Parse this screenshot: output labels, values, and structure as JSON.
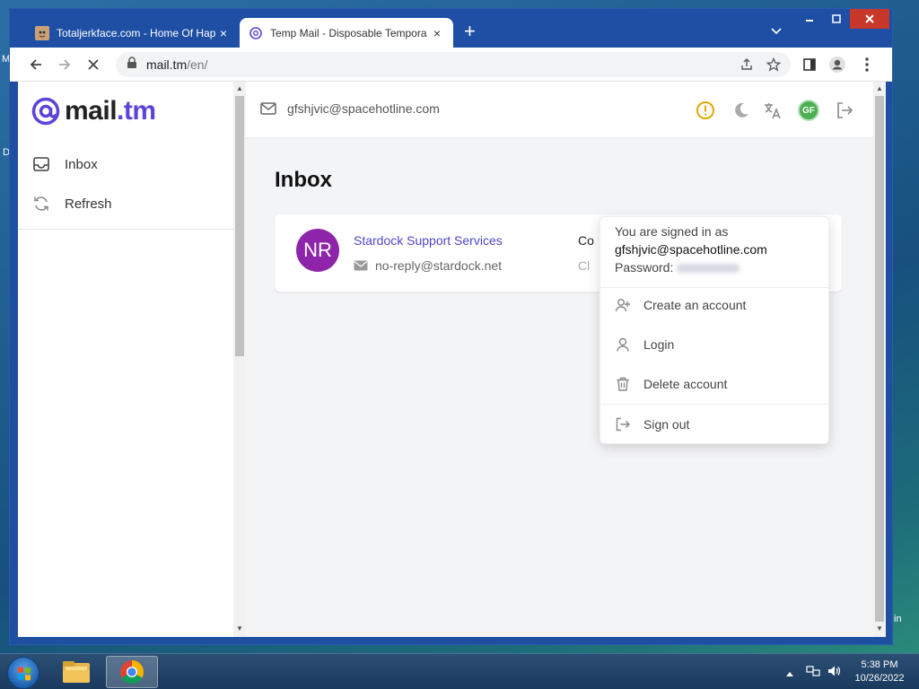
{
  "desktop": {
    "left_labels": [
      "M",
      "D"
    ],
    "right_label": "in"
  },
  "browser": {
    "tabs": [
      {
        "title": "Totaljerkface.com - Home Of Hap",
        "close": "×"
      },
      {
        "title": "Temp Mail - Disposable Tempora",
        "close": "×"
      }
    ],
    "new_tab": "+",
    "url_host": "mail.tm",
    "url_path": "/en/"
  },
  "sidebar": {
    "logo_at": "@",
    "logo_mail": "mail",
    "logo_tm": ".tm",
    "items": [
      {
        "label": "Inbox",
        "icon": "inbox-icon"
      },
      {
        "label": "Refresh",
        "icon": "refresh-icon"
      }
    ]
  },
  "header": {
    "email": "gfshjvic@spacehotline.com",
    "avatar_initials": "GF",
    "colors": {
      "warning": "#e0a800",
      "avatar": "#4caf50"
    }
  },
  "main": {
    "title": "Inbox",
    "messages": [
      {
        "initials": "NR",
        "sender": "Stardock Support Services",
        "from": "no-reply@stardock.net",
        "subject": "Co",
        "snippet": "Cl",
        "avatar_color": "#8e24aa"
      }
    ]
  },
  "dropdown": {
    "signed_in_label": "You are signed in as",
    "email": "gfshjvic@spacehotline.com",
    "password_label": "Password:",
    "items": [
      {
        "label": "Create an account",
        "icon": "user-plus-icon"
      },
      {
        "label": "Login",
        "icon": "user-icon"
      },
      {
        "label": "Delete account",
        "icon": "trash-icon"
      },
      {
        "label": "Sign out",
        "icon": "sign-out-icon"
      }
    ]
  },
  "taskbar": {
    "time": "5:38 PM",
    "date": "10/26/2022"
  },
  "accent": "#5b44d8"
}
